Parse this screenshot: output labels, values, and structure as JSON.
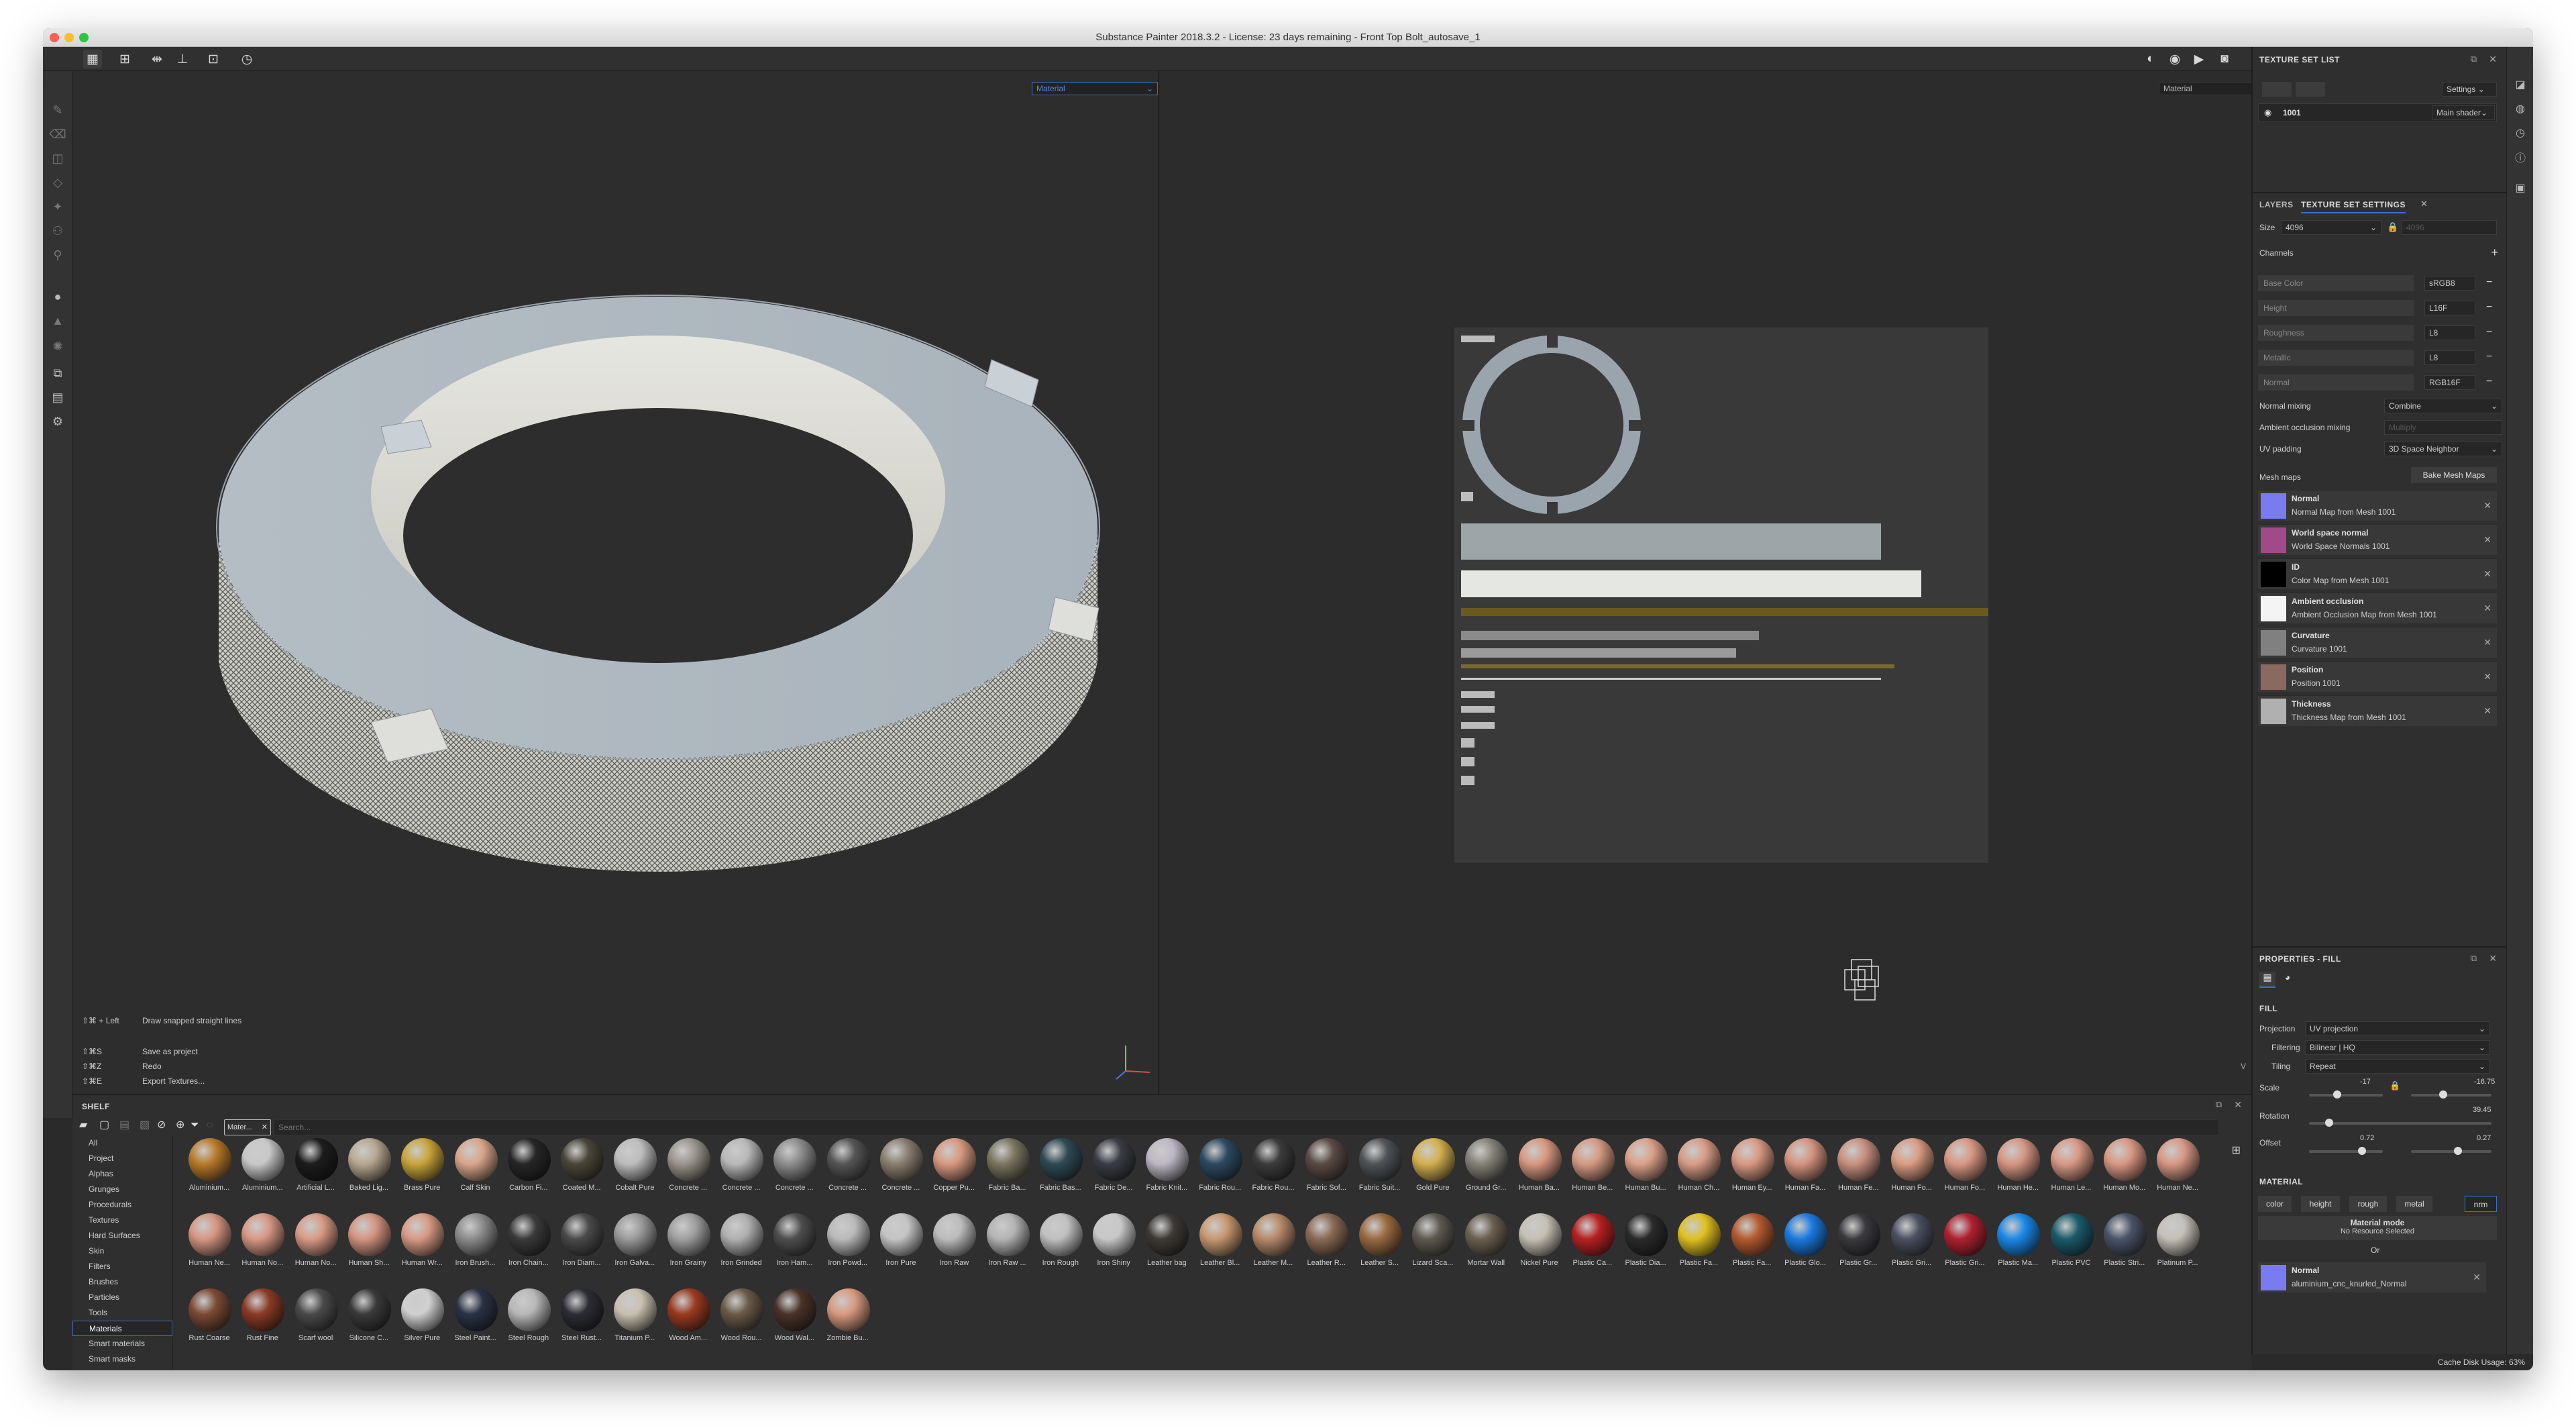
{
  "window": {
    "title": "Substance Painter 2018.3.2 - License: 23 days remaining - Front Top Bolt_autosave_1"
  },
  "colors": {
    "accent": "#3f6fc4",
    "close": "#fe5f57",
    "minimize": "#febc2e",
    "zoom": "#28c840"
  },
  "viewports": {
    "left_mode": "Material",
    "right_mode": "Material"
  },
  "shortcuts": [
    {
      "keys": "⇧⌘ + Left",
      "action": "Draw snapped straight lines"
    },
    {
      "keys": "⇧⌘S",
      "action": "Save as project"
    },
    {
      "keys": "⇧⌘Z",
      "action": "Redo"
    },
    {
      "keys": "⇧⌘E",
      "action": "Export Textures..."
    }
  ],
  "shelf": {
    "title": "SHELF",
    "filter_tag": "Mater...",
    "search_placeholder": "Search...",
    "categories": [
      "All",
      "Project",
      "Alphas",
      "Grunges",
      "Procedurals",
      "Textures",
      "Hard Surfaces",
      "Skin",
      "Filters",
      "Brushes",
      "Particles",
      "Tools",
      "Materials",
      "Smart materials",
      "Smart masks"
    ],
    "selected_category": "Materials",
    "materials": [
      {
        "name": "Aluminium...",
        "c": "#b87a2a"
      },
      {
        "name": "Aluminium...",
        "c": "#c8c8c8"
      },
      {
        "name": "Artificial L...",
        "c": "#1c1c1c"
      },
      {
        "name": "Baked Lig...",
        "c": "#b8a890"
      },
      {
        "name": "Brass Pure",
        "c": "#c9a53a"
      },
      {
        "name": "Calf Skin",
        "c": "#d9a68a"
      },
      {
        "name": "Carbon Fi...",
        "c": "#262626"
      },
      {
        "name": "Coated M...",
        "c": "#4a4638"
      },
      {
        "name": "Cobalt Pure",
        "c": "#bdbdbd"
      },
      {
        "name": "Concrete ...",
        "c": "#9a958c"
      },
      {
        "name": "Concrete ...",
        "c": "#b8b8b8"
      },
      {
        "name": "Concrete ...",
        "c": "#8d8d8d"
      },
      {
        "name": "Concrete ...",
        "c": "#555555"
      },
      {
        "name": "Concrete ...",
        "c": "#8a7f70"
      },
      {
        "name": "Copper Pu...",
        "c": "#d89a80"
      },
      {
        "name": "Fabric Ba...",
        "c": "#7a7660"
      },
      {
        "name": "Fabric Bas...",
        "c": "#2e4a54"
      },
      {
        "name": "Fabric De...",
        "c": "#3a3d44"
      },
      {
        "name": "Fabric Knit...",
        "c": "#bdb8c4"
      },
      {
        "name": "Fabric Rou...",
        "c": "#2c4a60"
      },
      {
        "name": "Fabric Rou...",
        "c": "#3c3c3c"
      },
      {
        "name": "Fabric Sof...",
        "c": "#5a4a44"
      },
      {
        "name": "Fabric Suit...",
        "c": "#505458"
      },
      {
        "name": "Gold Pure",
        "c": "#d4b050"
      },
      {
        "name": "Ground Gr...",
        "c": "#858278"
      },
      {
        "name": "Human Ba...",
        "c": "#d99880"
      },
      {
        "name": "Human Be...",
        "c": "#d69a84"
      },
      {
        "name": "Human Bu...",
        "c": "#dba18a"
      },
      {
        "name": "Human Ch...",
        "c": "#d89c86"
      },
      {
        "name": "Human Ey...",
        "c": "#d99a84"
      },
      {
        "name": "Human Fa...",
        "c": "#d49480"
      },
      {
        "name": "Human Fe...",
        "c": "#c89080"
      },
      {
        "name": "Human Fo...",
        "c": "#da9c84"
      },
      {
        "name": "Human Fo...",
        "c": "#d89884"
      },
      {
        "name": "Human He...",
        "c": "#d69682"
      },
      {
        "name": "Human Le...",
        "c": "#d89a86"
      },
      {
        "name": "Human Mo...",
        "c": "#d99884"
      },
      {
        "name": "Human Ne...",
        "c": "#d79884"
      },
      {
        "name": "Human Ne...",
        "c": "#d69682"
      },
      {
        "name": "Human No...",
        "c": "#d89884"
      },
      {
        "name": "Human No...",
        "c": "#d99a86"
      },
      {
        "name": "Human Sh...",
        "c": "#d49480"
      },
      {
        "name": "Human Wr...",
        "c": "#d89a84"
      },
      {
        "name": "Iron Brush...",
        "c": "#8c8c8c"
      },
      {
        "name": "Iron Chain...",
        "c": "#3a3a3a"
      },
      {
        "name": "Iron Diam...",
        "c": "#4a4a4a"
      },
      {
        "name": "Iron Galva...",
        "c": "#9a9a9a"
      },
      {
        "name": "Iron Grainy",
        "c": "#a0a0a0"
      },
      {
        "name": "Iron Grinded",
        "c": "#b0b0b0"
      },
      {
        "name": "Iron Ham...",
        "c": "#4e4e4e"
      },
      {
        "name": "Iron Powd...",
        "c": "#bababa"
      },
      {
        "name": "Iron Pure",
        "c": "#c4c4c4"
      },
      {
        "name": "Iron Raw",
        "c": "#bcbcbc"
      },
      {
        "name": "Iron Raw ...",
        "c": "#b4b4b4"
      },
      {
        "name": "Iron Rough",
        "c": "#c0c0c0"
      },
      {
        "name": "Iron Shiny",
        "c": "#c8c8c8"
      },
      {
        "name": "Leather bag",
        "c": "#3e3a36"
      },
      {
        "name": "Leather Bl...",
        "c": "#c89870"
      },
      {
        "name": "Leather M...",
        "c": "#b88a6a"
      },
      {
        "name": "Leather R...",
        "c": "#8a6a54"
      },
      {
        "name": "Leather S...",
        "c": "#9a6a40"
      },
      {
        "name": "Lizard Sca...",
        "c": "#5e5a50"
      },
      {
        "name": "Mortar Wall",
        "c": "#6a6050"
      },
      {
        "name": "Nickel Pure",
        "c": "#c6c0b4"
      },
      {
        "name": "Plastic Ca...",
        "c": "#b82020"
      },
      {
        "name": "Plastic Dia...",
        "c": "#2a2a2a"
      },
      {
        "name": "Plastic Fa...",
        "c": "#e0c020"
      },
      {
        "name": "Plastic Fa...",
        "c": "#b45a30"
      },
      {
        "name": "Plastic Glo...",
        "c": "#1a7ae0"
      },
      {
        "name": "Plastic Gr...",
        "c": "#3a3a3e"
      },
      {
        "name": "Plastic Gri...",
        "c": "#4a5060"
      },
      {
        "name": "Plastic Gri...",
        "c": "#b02030"
      },
      {
        "name": "Plastic Ma...",
        "c": "#1a88e8"
      },
      {
        "name": "Plastic PVC",
        "c": "#1a5a6a"
      },
      {
        "name": "Plastic Stri...",
        "c": "#4a5468"
      },
      {
        "name": "Platinum P...",
        "c": "#c4c0b8"
      },
      {
        "name": "Rust Coarse",
        "c": "#7a4a34"
      },
      {
        "name": "Rust Fine",
        "c": "#8a3a24"
      },
      {
        "name": "Scarf wool",
        "c": "#4a4a4a"
      },
      {
        "name": "Silicone C...",
        "c": "#3a3a3a"
      },
      {
        "name": "Silver Pure",
        "c": "#d0d0d0"
      },
      {
        "name": "Steel Paint...",
        "c": "#2a3244"
      },
      {
        "name": "Steel Rough",
        "c": "#b8b8b8"
      },
      {
        "name": "Steel Rust...",
        "c": "#2c2c34"
      },
      {
        "name": "Titanium P...",
        "c": "#c8c0b0"
      },
      {
        "name": "Wood Am...",
        "c": "#9a3a20"
      },
      {
        "name": "Wood Rou...",
        "c": "#6a5a48"
      },
      {
        "name": "Wood Wal...",
        "c": "#4a3228"
      },
      {
        "name": "Zombie Bu...",
        "c": "#d89a80"
      }
    ]
  },
  "texture_set_list": {
    "title": "TEXTURE SET LIST",
    "settings_label": "Settings",
    "set_name": "1001",
    "shader": "Main shader"
  },
  "tabs": {
    "layers": "LAYERS",
    "tss": "TEXTURE SET SETTINGS"
  },
  "tss": {
    "size_label": "Size",
    "size_value": "4096",
    "size_value2": "4096",
    "channels_label": "Channels",
    "channels": [
      {
        "name": "Base Color",
        "fmt": "sRGB8"
      },
      {
        "name": "Height",
        "fmt": "L16F"
      },
      {
        "name": "Roughness",
        "fmt": "L8"
      },
      {
        "name": "Metallic",
        "fmt": "L8"
      },
      {
        "name": "Normal",
        "fmt": "RGB16F"
      }
    ],
    "normal_mixing_label": "Normal mixing",
    "normal_mixing": "Combine",
    "ao_mixing_label": "Ambient occlusion mixing",
    "ao_mixing": "Multiply",
    "uv_padding_label": "UV padding",
    "uv_padding": "3D Space Neighbor",
    "mesh_maps_label": "Mesh maps",
    "bake_button": "Bake Mesh Maps",
    "mesh_maps": [
      {
        "title": "Normal",
        "sub": "Normal Map from Mesh 1001",
        "c": "#7b7bf0"
      },
      {
        "title": "World space normal",
        "sub": "World Space Normals 1001",
        "c": "#a04a8a"
      },
      {
        "title": "ID",
        "sub": "Color Map from Mesh 1001",
        "c": "#000000"
      },
      {
        "title": "Ambient occlusion",
        "sub": "Ambient Occlusion Map from Mesh 1001",
        "c": "#f4f4f4"
      },
      {
        "title": "Curvature",
        "sub": "Curvature 1001",
        "c": "#808080"
      },
      {
        "title": "Position",
        "sub": "Position 1001",
        "c": "#8a6a60"
      },
      {
        "title": "Thickness",
        "sub": "Thickness Map from Mesh 1001",
        "c": "#b0b0b0"
      }
    ]
  },
  "properties": {
    "title": "PROPERTIES - FILL",
    "fill_label": "FILL",
    "projection_label": "Projection",
    "projection": "UV projection",
    "filtering_label": "Filtering",
    "filtering": "Bilinear | HQ",
    "tiling_label": "Tiling",
    "tiling": "Repeat",
    "scale_label": "Scale",
    "scale_u": "-17",
    "scale_v": "-16.75",
    "scale_u_pos": 0.38,
    "scale_v_pos": 0.4,
    "rotation_label": "Rotation",
    "rotation": "39.45",
    "rotation_pos": 0.11,
    "offset_label": "Offset",
    "offset_u": "0.72",
    "offset_v": "0.27",
    "offset_u_pos": 0.72,
    "offset_v_pos": 0.58,
    "material_label": "MATERIAL",
    "channel_buttons": [
      "color",
      "height",
      "rough",
      "metal",
      "nrm"
    ],
    "active_channel": "nrm",
    "material_mode_title": "Material mode",
    "material_mode_sub": "No Resource Selected",
    "or_label": "Or",
    "normal_title": "Normal",
    "normal_sub": "aluminium_cnc_knurled_Normal"
  },
  "status": {
    "cache": "Cache Disk Usage:",
    "cache_value": "63%"
  }
}
